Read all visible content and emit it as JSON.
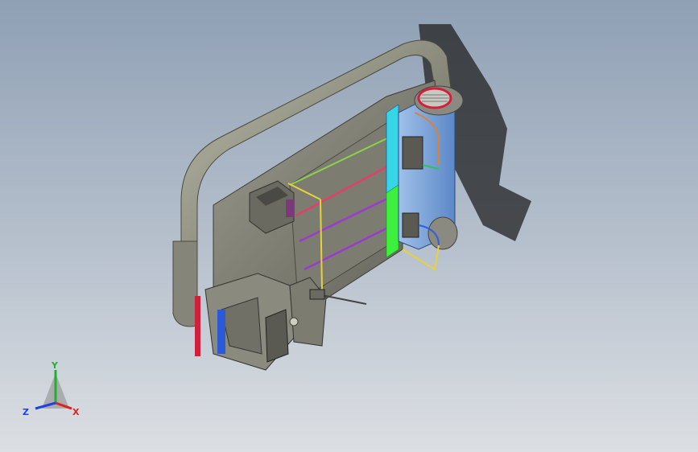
{
  "viewport": {
    "background_top": "#8fa0b5",
    "background_bottom": "#dcdfe3"
  },
  "triad": {
    "x_label": "X",
    "y_label": "Y",
    "z_label": "Z",
    "x_color": "#e02020",
    "y_color": "#20b030",
    "z_color": "#2040e0"
  },
  "model": {
    "pipe_color": "#8f8f80",
    "housing_color": "#7d7d72",
    "cyan_panel": "#35d6e6",
    "green_panel": "#3df03d",
    "blue_panel": "#6f9fd8",
    "red_strip": "#d0203c",
    "blue_strip": "#2a5ad8"
  }
}
